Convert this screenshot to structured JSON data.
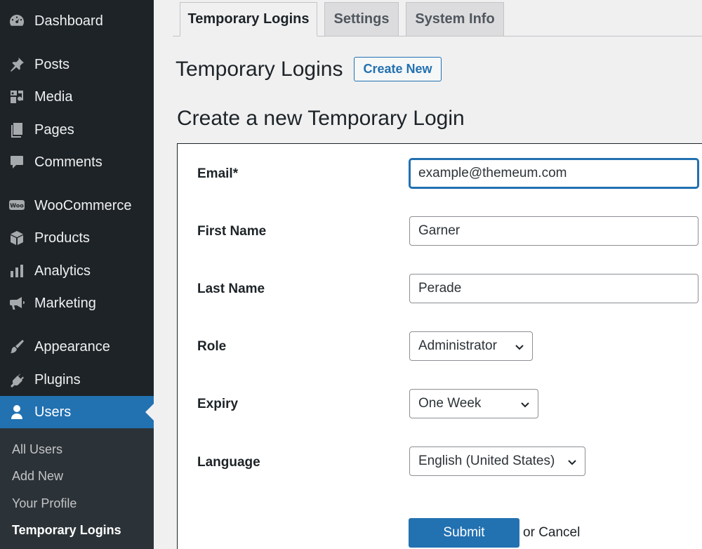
{
  "sidebar": {
    "items": [
      {
        "label": "Dashboard",
        "icon": "dashboard-icon"
      },
      {
        "label": "Posts",
        "icon": "pin-icon"
      },
      {
        "label": "Media",
        "icon": "media-icon"
      },
      {
        "label": "Pages",
        "icon": "pages-icon"
      },
      {
        "label": "Comments",
        "icon": "comment-icon"
      },
      {
        "label": "WooCommerce",
        "icon": "woo-icon",
        "icon_text": "Woo"
      },
      {
        "label": "Products",
        "icon": "box-icon"
      },
      {
        "label": "Analytics",
        "icon": "bar-chart-icon"
      },
      {
        "label": "Marketing",
        "icon": "megaphone-icon"
      },
      {
        "label": "Appearance",
        "icon": "brush-icon"
      },
      {
        "label": "Plugins",
        "icon": "plug-icon"
      },
      {
        "label": "Users",
        "icon": "user-icon"
      }
    ],
    "submenu": [
      {
        "label": "All Users"
      },
      {
        "label": "Add New"
      },
      {
        "label": "Your Profile"
      },
      {
        "label": "Temporary Logins"
      }
    ]
  },
  "tabs": [
    {
      "label": "Temporary Logins"
    },
    {
      "label": "Settings"
    },
    {
      "label": "System Info"
    }
  ],
  "header": {
    "title": "Temporary Logins",
    "create_new_label": "Create New",
    "section_title": "Create a new Temporary Login"
  },
  "form": {
    "email": {
      "label": "Email*",
      "value": "example@themeum.com"
    },
    "first_name": {
      "label": "First Name",
      "value": "Garner"
    },
    "last_name": {
      "label": "Last Name",
      "value": "Perade"
    },
    "role": {
      "label": "Role",
      "value": "Administrator"
    },
    "expiry": {
      "label": "Expiry",
      "value": "One Week"
    },
    "language": {
      "label": "Language",
      "value": "English (United States)"
    },
    "submit_label": "Submit",
    "or_label": "or",
    "cancel_label": "Cancel"
  },
  "colors": {
    "sidebar_bg": "#1d2327",
    "accent": "#2271b1",
    "page_bg": "#f0f0f1"
  }
}
